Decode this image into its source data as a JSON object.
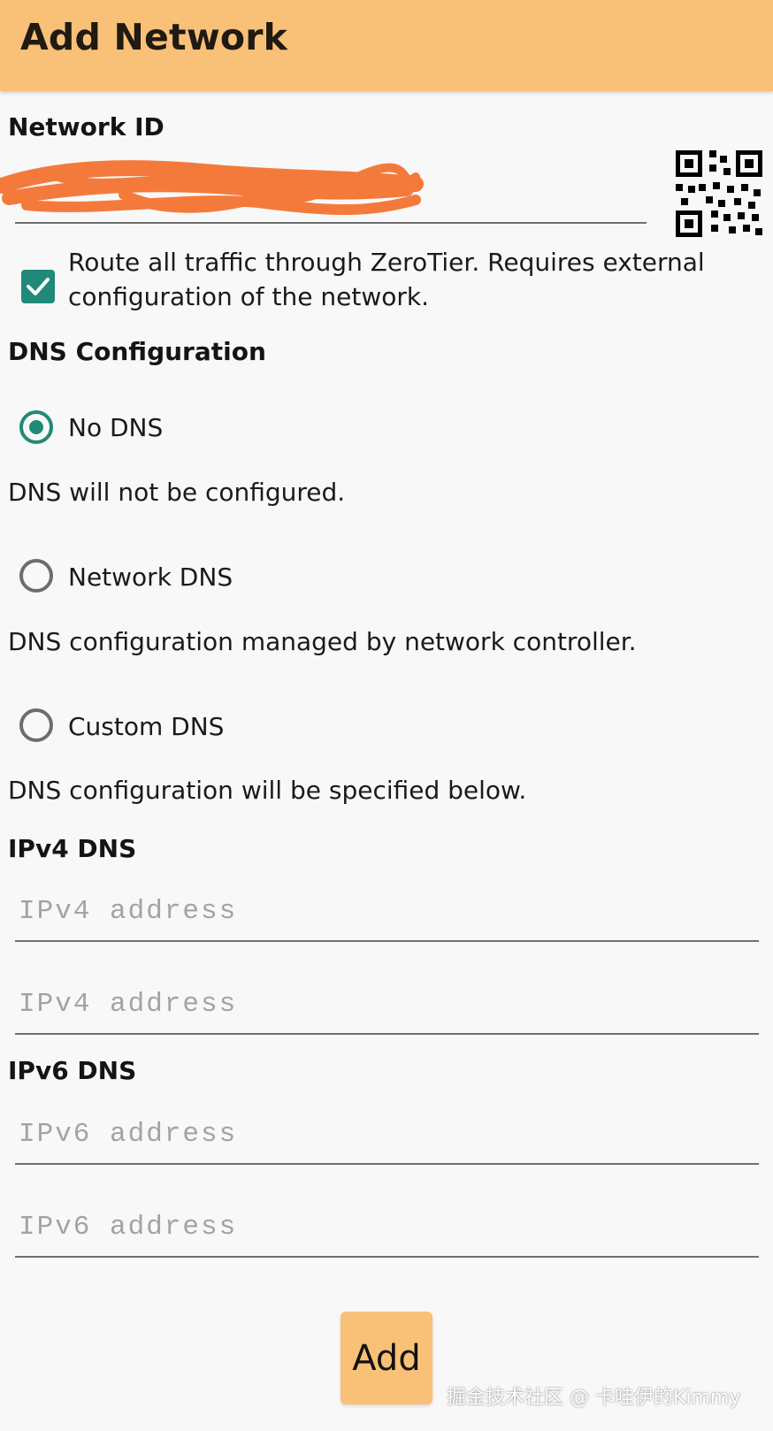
{
  "app_bar": {
    "title": "Add Network"
  },
  "network_id": {
    "label": "Network ID",
    "value": ""
  },
  "route_all": {
    "checked": true,
    "line1": "Route all traffic through ZeroTier. Requires external",
    "line2": "configuration of the network."
  },
  "dns": {
    "label": "DNS Configuration",
    "options": [
      {
        "label": "No DNS",
        "selected": true,
        "description": "DNS will not be configured."
      },
      {
        "label": "Network DNS",
        "selected": false,
        "description": "DNS configuration managed by network controller."
      },
      {
        "label": "Custom DNS",
        "selected": false,
        "description": "DNS configuration will be specified below."
      }
    ]
  },
  "ipv4": {
    "label": "IPv4 DNS",
    "placeholder": "IPv4 address"
  },
  "ipv6": {
    "label": "IPv6 DNS",
    "placeholder": "IPv6 address"
  },
  "add_button": {
    "label": "Add"
  },
  "watermark": "掘金技术社区 @ 卡哇伊的Kimmy",
  "colors": {
    "app_bar": "#f9c077",
    "accent": "#1f8a78",
    "redaction": "#f47a3c"
  }
}
